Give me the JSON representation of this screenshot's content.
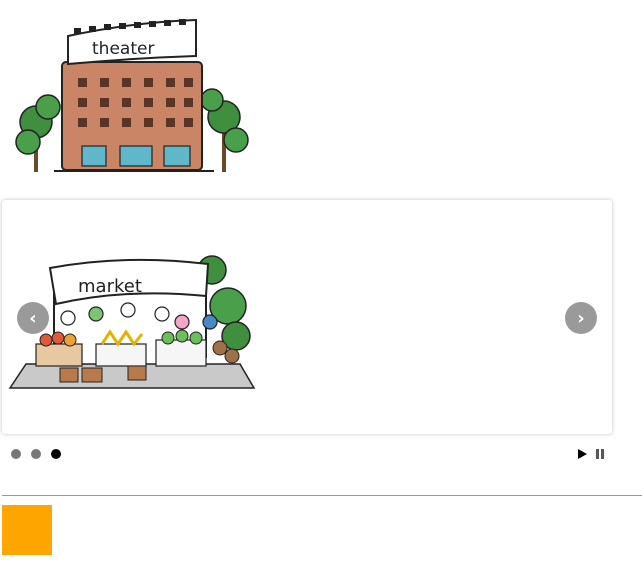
{
  "theater": {
    "sign_text": "theater"
  },
  "carousel": {
    "slide_sign_text": "market",
    "prev_icon": "chevron-left-icon",
    "next_icon": "chevron-right-icon",
    "prev_glyph": "‹",
    "next_glyph": "›",
    "dots": [
      {
        "active": false
      },
      {
        "active": false
      },
      {
        "active": true
      }
    ],
    "play_icon": "play-icon",
    "pause_icon": "pause-icon"
  },
  "colors": {
    "orange_block": "#FFA500",
    "dot_active": "#000000",
    "dot_inactive": "#777777",
    "divider": "#999999"
  }
}
